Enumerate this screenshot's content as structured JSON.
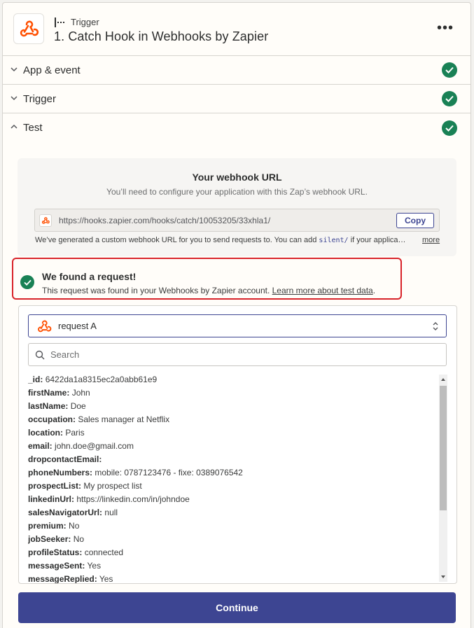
{
  "header": {
    "step_type": "Trigger",
    "title": "1. Catch Hook in Webhooks by Zapier",
    "more_label": "•••"
  },
  "accordion": [
    {
      "label": "App & event",
      "state": "collapsed",
      "status": "complete"
    },
    {
      "label": "Trigger",
      "state": "collapsed",
      "status": "complete"
    },
    {
      "label": "Test",
      "state": "expanded",
      "status": "complete"
    }
  ],
  "webhook": {
    "title": "Your webhook URL",
    "subtitle": "You’ll need to configure your application with this Zap’s webhook URL.",
    "url": "https://hooks.zapier.com/hooks/catch/10053205/33xhla1/",
    "copy_label": "Copy",
    "note_before": "We’ve generated a custom webhook URL for you to send requests to. You can add ",
    "note_code": "silent/",
    "note_after": " if your applicati...",
    "more_label": "more"
  },
  "found": {
    "title": "We found a request!",
    "text": "This request was found in your Webhooks by Zapier account. ",
    "link": "Learn more about test data",
    "link_suffix": "."
  },
  "request": {
    "selected": "request A",
    "search_placeholder": "Search",
    "fields": [
      {
        "key": "_id:",
        "value": "6422da1a8315ec2a0abb61e9"
      },
      {
        "key": "firstName:",
        "value": "John"
      },
      {
        "key": "lastName:",
        "value": "Doe"
      },
      {
        "key": "occupation:",
        "value": "Sales manager at Netflix"
      },
      {
        "key": "location:",
        "value": "Paris"
      },
      {
        "key": "email:",
        "value": "john.doe@gmail.com"
      },
      {
        "key": "dropcontactEmail:",
        "value": ""
      },
      {
        "key": "phoneNumbers:",
        "value": "mobile: 0787123476 - fixe: 0389076542"
      },
      {
        "key": "prospectList:",
        "value": "My prospect list"
      },
      {
        "key": "linkedinUrl:",
        "value": "https://linkedin.com/in/johndoe"
      },
      {
        "key": "salesNavigatorUrl:",
        "value": "null"
      },
      {
        "key": "premium:",
        "value": "No"
      },
      {
        "key": "jobSeeker:",
        "value": "No"
      },
      {
        "key": "profileStatus:",
        "value": "connected"
      },
      {
        "key": "messageSent:",
        "value": "Yes"
      },
      {
        "key": "messageReplied:",
        "value": "Yes"
      }
    ]
  },
  "continue_label": "Continue",
  "colors": {
    "accent": "#3d4592",
    "success": "#198155",
    "highlight_border": "#d8232a",
    "webhook_orange": "#ff4f00"
  }
}
